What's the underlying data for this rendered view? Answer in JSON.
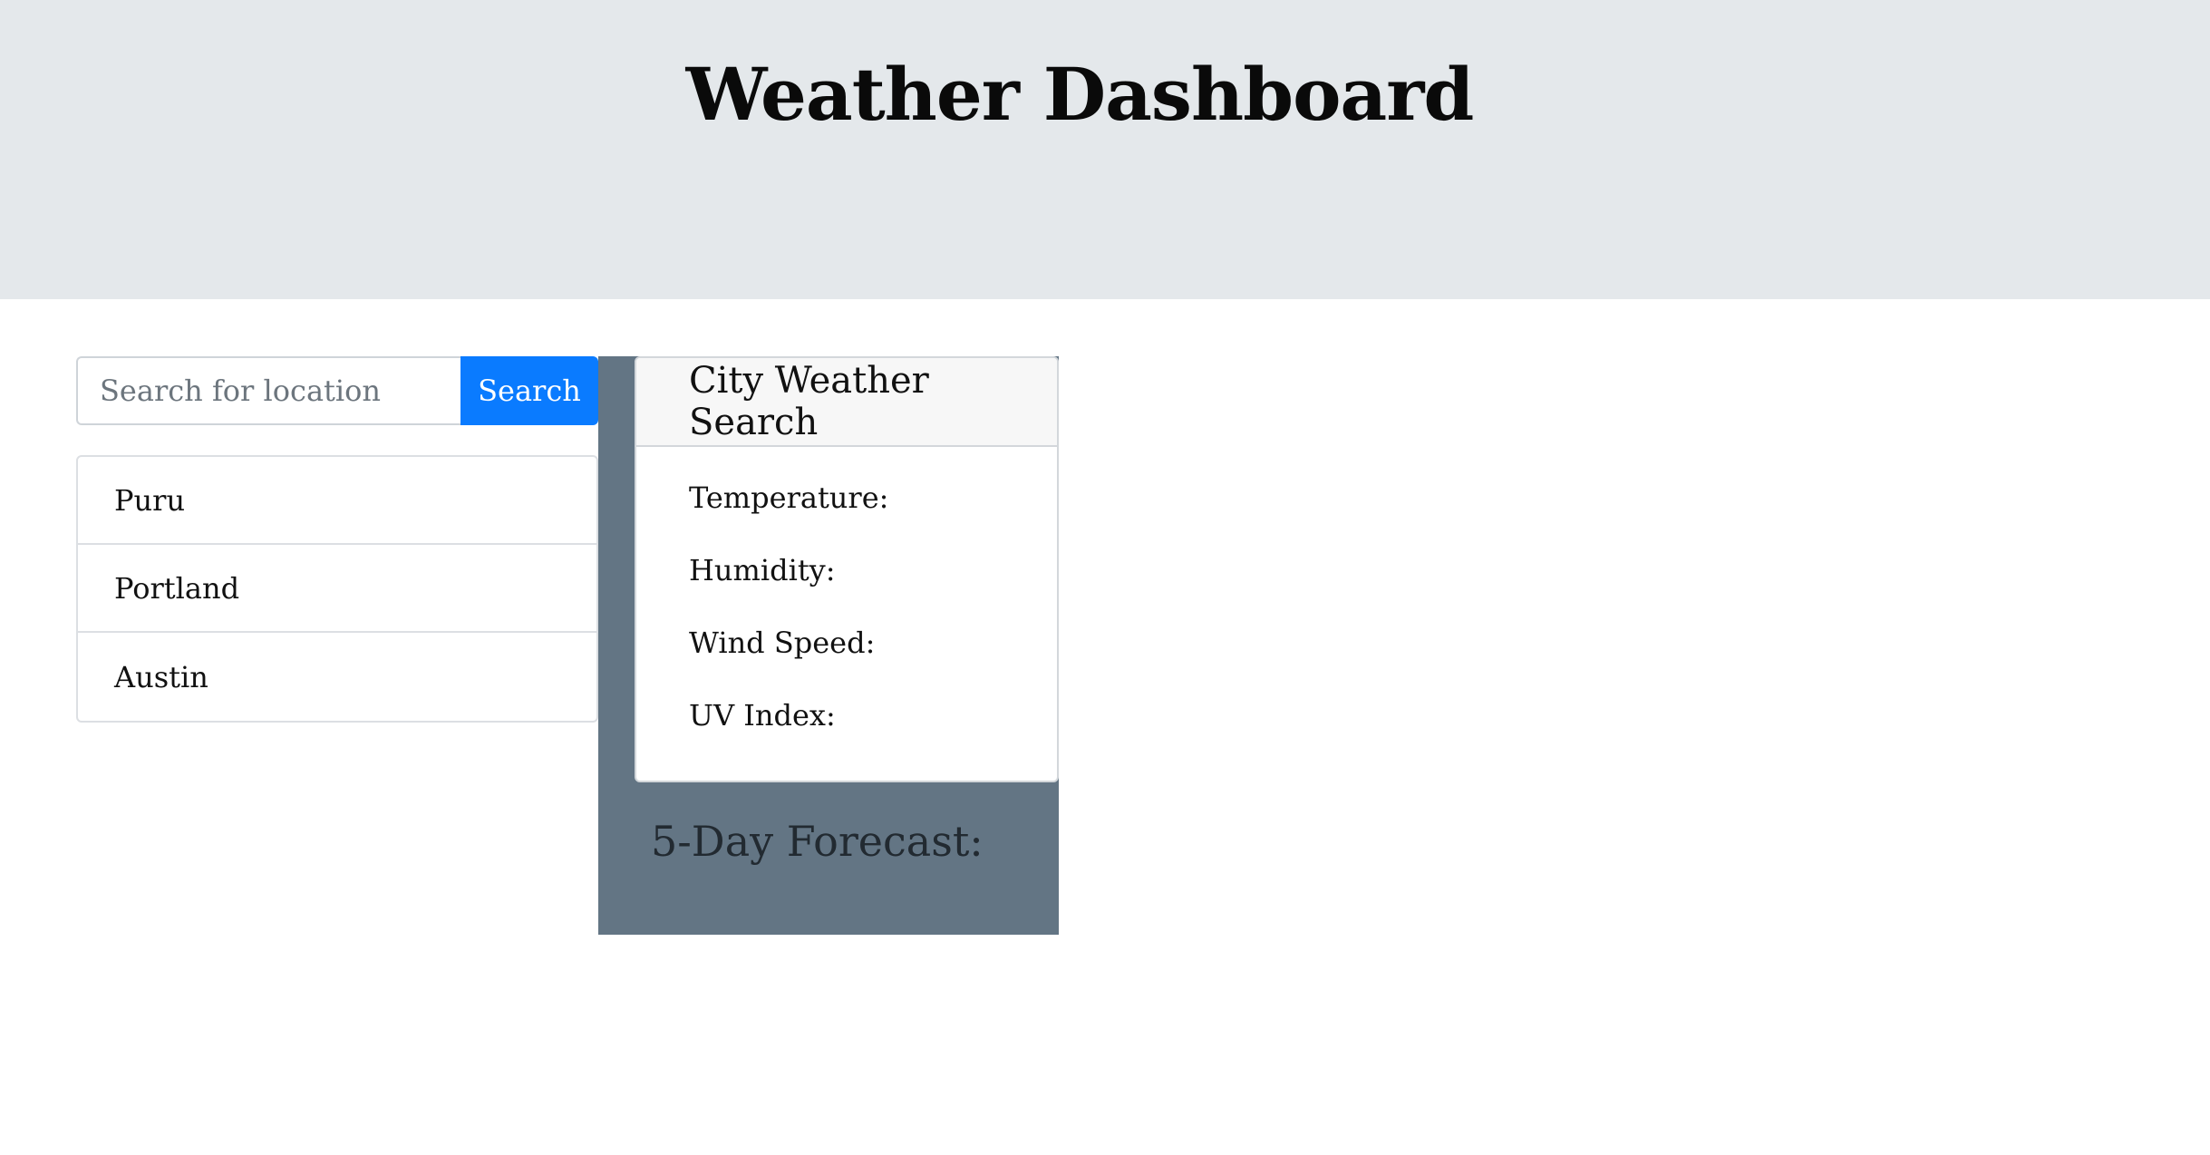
{
  "header": {
    "title": "Weather Dashboard"
  },
  "search": {
    "placeholder": "Search for location",
    "value": "",
    "button_label": "Search"
  },
  "history": {
    "items": [
      {
        "label": "Puru"
      },
      {
        "label": "Portland"
      },
      {
        "label": "Austin"
      }
    ]
  },
  "current_weather": {
    "title": "City Weather Search",
    "temperature_label": "Temperature:",
    "humidity_label": "Humidity:",
    "wind_speed_label": "Wind Speed:",
    "uv_index_label": "UV Index:"
  },
  "forecast": {
    "title": "5-Day Forecast:"
  },
  "colors": {
    "jumbotron_bg": "#e4e8eb",
    "primary_button": "#0a7bff",
    "panel_bg": "#637584"
  }
}
